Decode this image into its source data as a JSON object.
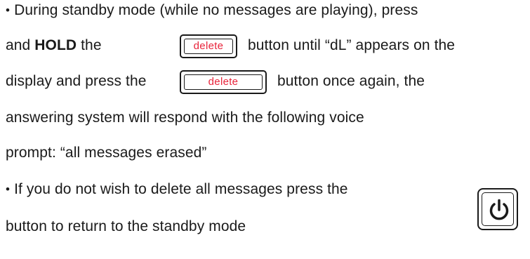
{
  "bullet_glyph": "•",
  "para1": {
    "line1": "During standby mode (while no messages are playing), press",
    "line2_prefix": "and ",
    "line2_bold": "HOLD",
    "line2_mid": " the",
    "line2_suffix": "button until “dL” appears on the",
    "line3_prefix": "display and press the",
    "line3_suffix": "button once again, the",
    "line4": "answering system will respond with the following voice",
    "line5": "prompt: “all messages erased”"
  },
  "delete_button": {
    "label": "delete",
    "label_color": "#e8243b"
  },
  "para2": {
    "line1": "If you do not wish to delete all messages press the",
    "line2": "button to return to the standby mode"
  },
  "power_button": {
    "icon": "power-icon"
  }
}
